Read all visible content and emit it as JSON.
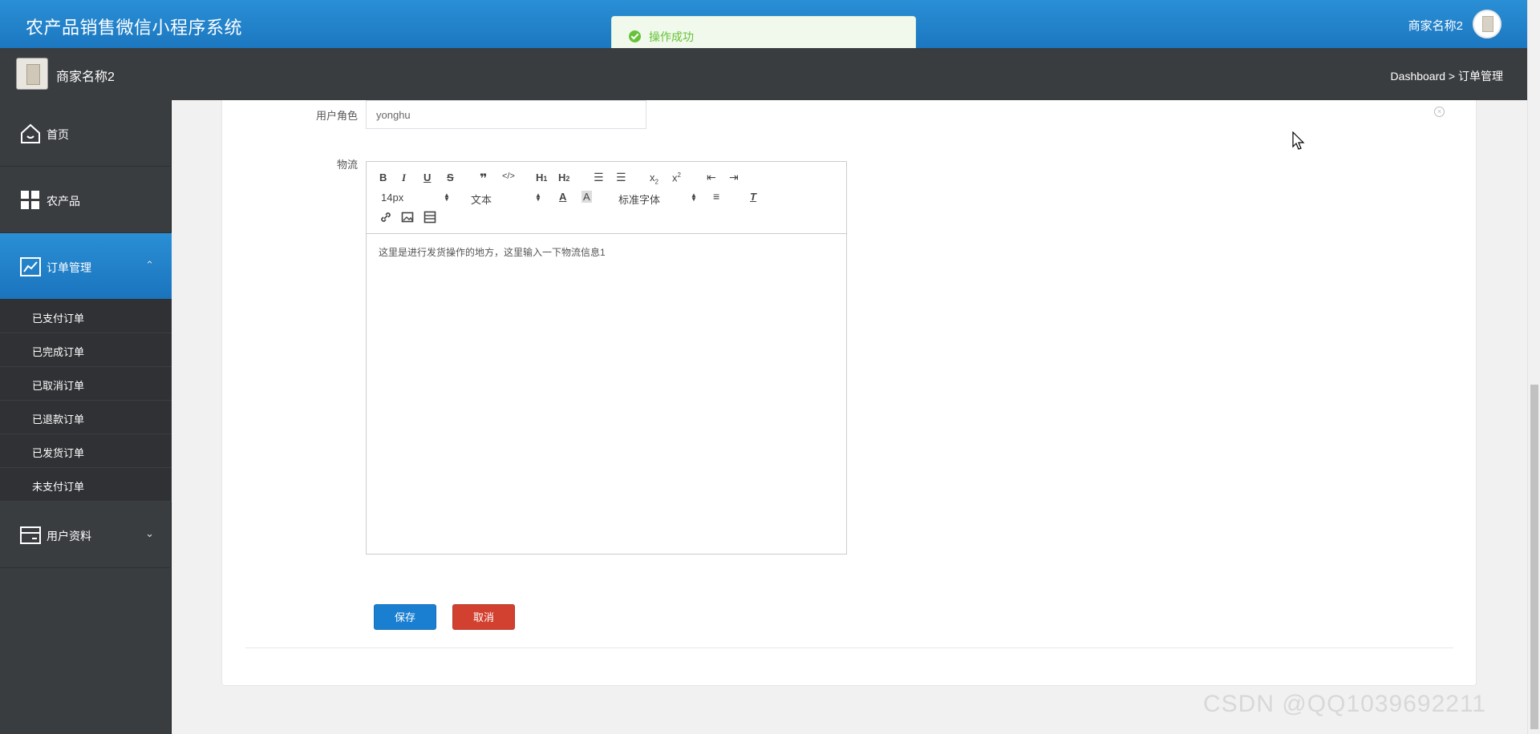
{
  "header": {
    "app_title": "农产品销售微信小程序系统",
    "user_name": "商家名称2"
  },
  "toast": {
    "message": "操作成功",
    "color": "#67c23a"
  },
  "subheader": {
    "shop_name": "商家名称2",
    "breadcrumb": "Dashboard > 订单管理"
  },
  "sidebar": {
    "items": [
      {
        "label": "首页",
        "icon": "home-icon"
      },
      {
        "label": "农产品",
        "icon": "grid-icon"
      },
      {
        "label": "订单管理",
        "icon": "chart-icon",
        "chevron": "⌃"
      },
      {
        "label": "用户资料",
        "icon": "card-icon",
        "chevron": "⌄"
      }
    ],
    "submenu": [
      "已支付订单",
      "已完成订单",
      "已取消订单",
      "已退款订单",
      "已发货订单",
      "未支付订单"
    ]
  },
  "form": {
    "role_label": "用户角色",
    "role_value": "yonghu",
    "logistics_label": "物流",
    "editor": {
      "font_size": "14px",
      "text_style": "文本",
      "font_family": "标准字体",
      "content": "这里是进行发货操作的地方，这里输入一下物流信息1"
    },
    "save_label": "保存",
    "cancel_label": "取消"
  },
  "colors": {
    "primary": "#1a7fd0",
    "danger": "#d2402f",
    "sidebar_bg": "#3a3d40"
  },
  "watermark": "CSDN @QQ1039692211"
}
